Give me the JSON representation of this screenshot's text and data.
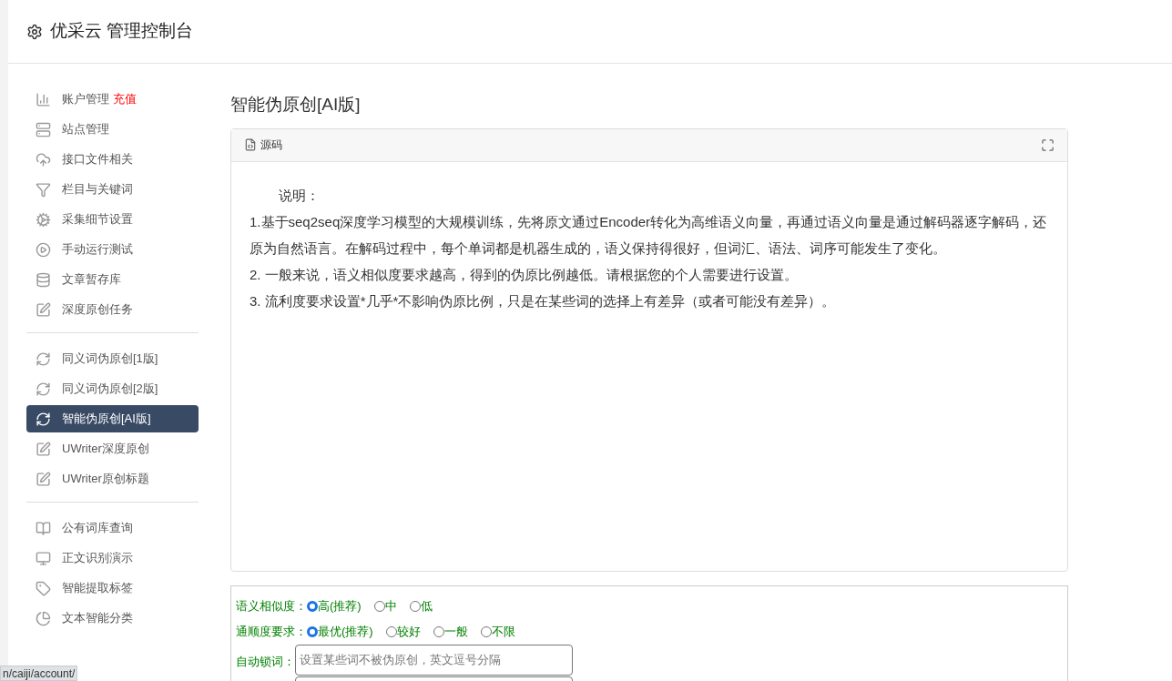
{
  "header": {
    "title": "优采云 管理控制台"
  },
  "sidebar": {
    "groups": [
      {
        "items": [
          {
            "label": "账户管理",
            "badge": "充值",
            "selected": false
          },
          {
            "label": "站点管理",
            "selected": false
          },
          {
            "label": "接口文件相关",
            "selected": false
          },
          {
            "label": "栏目与关键词",
            "selected": false
          },
          {
            "label": "采集细节设置",
            "selected": false
          },
          {
            "label": "手动运行测试",
            "selected": false
          },
          {
            "label": "文章暂存库",
            "selected": false
          },
          {
            "label": "深度原创任务",
            "selected": false
          }
        ]
      },
      {
        "items": [
          {
            "label": "同义词伪原创[1版]",
            "selected": false
          },
          {
            "label": "同义词伪原创[2版]",
            "selected": false
          },
          {
            "label": "智能伪原创[AI版]",
            "selected": true
          },
          {
            "label": "UWriter深度原创",
            "selected": false
          },
          {
            "label": "UWriter原创标题",
            "selected": false
          }
        ]
      },
      {
        "items": [
          {
            "label": "公有词库查询",
            "selected": false
          },
          {
            "label": "正文识别演示",
            "selected": false
          },
          {
            "label": "智能提取标签",
            "selected": false
          },
          {
            "label": "文本智能分类",
            "selected": false
          }
        ]
      }
    ]
  },
  "main": {
    "title": "智能伪原创[AI版]",
    "editor": {
      "source_button": "源码",
      "lines": [
        "说明：",
        "1.基于seq2seq深度学习模型的大规模训练，先将原文通过Encoder转化为高维语义向量，再通过语义向量是通过解码器逐字解码，还原为自然语言。在解码过程中，每个单词都是机器生成的，语义保持得很好，但词汇、语法、词序可能发生了变化。",
        "2. 一般来说，语义相似度要求越高，得到的伪原比例越低。请根据您的个人需要进行设置。",
        "3. 流利度要求设置*几乎*不影响伪原比例，只是在某些词的选择上有差异（或者可能没有差异）。"
      ]
    },
    "form": {
      "rows": [
        {
          "kind": "radio",
          "label": "语义相似度：",
          "options": [
            {
              "label": "高(推荐)",
              "selected": true
            },
            {
              "label": "中",
              "selected": false
            },
            {
              "label": "低",
              "selected": false
            }
          ]
        },
        {
          "kind": "radio",
          "label": "通顺度要求：",
          "options": [
            {
              "label": "最优(推荐)",
              "selected": true
            },
            {
              "label": "较好",
              "selected": false
            },
            {
              "label": "一般",
              "selected": false
            },
            {
              "label": "不限",
              "selected": false
            }
          ]
        },
        {
          "kind": "input",
          "label": "自动锁词：",
          "placeholder": "设置某些词不被伪原创，英文逗号分隔"
        }
      ]
    }
  },
  "status_bar": {
    "url": "n/caiji/account/"
  }
}
